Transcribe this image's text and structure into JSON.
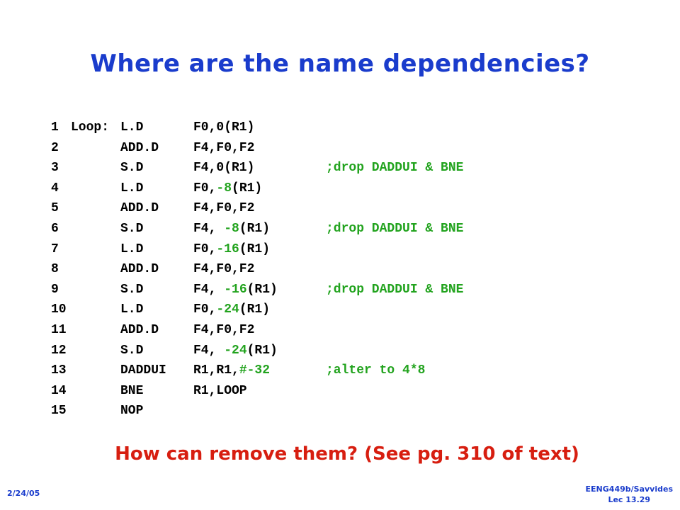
{
  "title": "Where are the name dependencies?",
  "colors": {
    "title": "#1a3ccc",
    "highlight": "#22a31e",
    "question": "#d71e10"
  },
  "code": [
    {
      "num": "1",
      "label": "Loop:",
      "op": "L.D",
      "args": [
        {
          "t": "F0,0(R1)"
        }
      ],
      "comment": ""
    },
    {
      "num": "2",
      "label": "",
      "op": "ADD.D",
      "args": [
        {
          "t": "F4,F0,F2"
        }
      ],
      "comment": ""
    },
    {
      "num": "3",
      "label": "",
      "op": "S.D",
      "args": [
        {
          "t": "F4,0(R1)"
        }
      ],
      "comment": ";drop DADDUI & BNE"
    },
    {
      "num": "4",
      "label": "",
      "op": "L.D",
      "args": [
        {
          "t": "F0,"
        },
        {
          "t": "-8",
          "hl": true
        },
        {
          "t": "(R1)"
        }
      ],
      "comment": ""
    },
    {
      "num": "5",
      "label": "",
      "op": "ADD.D",
      "args": [
        {
          "t": "F4,F0,F2"
        }
      ],
      "comment": ""
    },
    {
      "num": "6",
      "label": "",
      "op": "S.D",
      "args": [
        {
          "t": "F4, "
        },
        {
          "t": "-8",
          "hl": true
        },
        {
          "t": "(R1)"
        }
      ],
      "comment": ";drop DADDUI & BNE"
    },
    {
      "num": "7",
      "label": "",
      "op": "L.D",
      "args": [
        {
          "t": "F0,"
        },
        {
          "t": "-16",
          "hl": true
        },
        {
          "t": "(R1)"
        }
      ],
      "comment": ""
    },
    {
      "num": "8",
      "label": "",
      "op": "ADD.D",
      "args": [
        {
          "t": "F4,F0,F2"
        }
      ],
      "comment": ""
    },
    {
      "num": "9",
      "label": "",
      "op": "S.D",
      "args": [
        {
          "t": "F4, "
        },
        {
          "t": "-16",
          "hl": true
        },
        {
          "t": "(R1)"
        }
      ],
      "comment": ";drop DADDUI & BNE"
    },
    {
      "num": "10",
      "label": "",
      "op": "L.D",
      "args": [
        {
          "t": "F0,"
        },
        {
          "t": "-24",
          "hl": true
        },
        {
          "t": "(R1)"
        }
      ],
      "comment": ""
    },
    {
      "num": "11",
      "label": "",
      "op": "ADD.D",
      "args": [
        {
          "t": "F4,F0,F2"
        }
      ],
      "comment": ""
    },
    {
      "num": "12",
      "label": "",
      "op": "S.D",
      "args": [
        {
          "t": "F4, "
        },
        {
          "t": "-24",
          "hl": true
        },
        {
          "t": "(R1)"
        }
      ],
      "comment": ""
    },
    {
      "num": "13",
      "label": "",
      "op": "DADDUI",
      "args": [
        {
          "t": "R1,R1,"
        },
        {
          "t": "#-32",
          "hl": true
        }
      ],
      "comment": ";alter to 4*8"
    },
    {
      "num": "14",
      "label": "",
      "op": "BNE",
      "args": [
        {
          "t": "R1,LOOP"
        }
      ],
      "comment": ""
    },
    {
      "num": "15",
      "label": "",
      "op": "NOP",
      "args": [
        {
          "t": ""
        }
      ],
      "comment": ""
    }
  ],
  "question": "How can remove them? (See pg. 310 of text)",
  "footer": {
    "date": "2/24/05",
    "course": "EENG449b/Savvides",
    "lecture": "Lec 13.29"
  }
}
